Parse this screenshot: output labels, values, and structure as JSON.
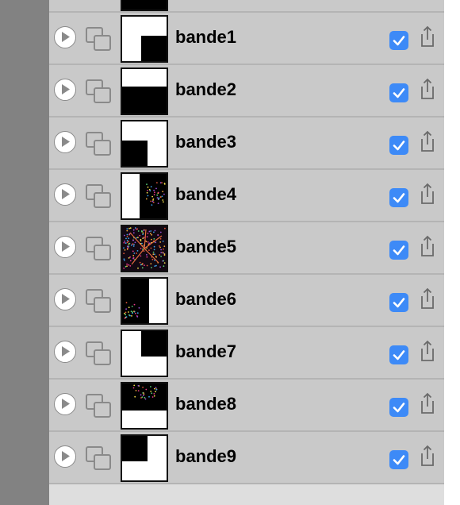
{
  "layers": [
    {
      "name": "bande1",
      "visible": true,
      "thumbnail": "mask-top-left-white"
    },
    {
      "name": "bande2",
      "visible": true,
      "thumbnail": "mask-top-white"
    },
    {
      "name": "bande3",
      "visible": true,
      "thumbnail": "mask-bottom-left-black"
    },
    {
      "name": "bande4",
      "visible": true,
      "thumbnail": "mask-left-white-colorful"
    },
    {
      "name": "bande5",
      "visible": true,
      "thumbnail": "colorful-image"
    },
    {
      "name": "bande6",
      "visible": true,
      "thumbnail": "mask-right-white-colorful"
    },
    {
      "name": "bande7",
      "visible": true,
      "thumbnail": "mask-top-right-black"
    },
    {
      "name": "bande8",
      "visible": true,
      "thumbnail": "mask-bottom-white-colorful"
    },
    {
      "name": "bande9",
      "visible": true,
      "thumbnail": "mask-top-left-black"
    }
  ],
  "icons": {
    "play": "play-circle-icon",
    "layers": "layers-icon",
    "checkbox": "checkmark-icon",
    "share": "share-icon"
  },
  "colors": {
    "left_rail": "#828282",
    "panel": "#c9c9c9",
    "checkbox": "#3d8af7"
  }
}
